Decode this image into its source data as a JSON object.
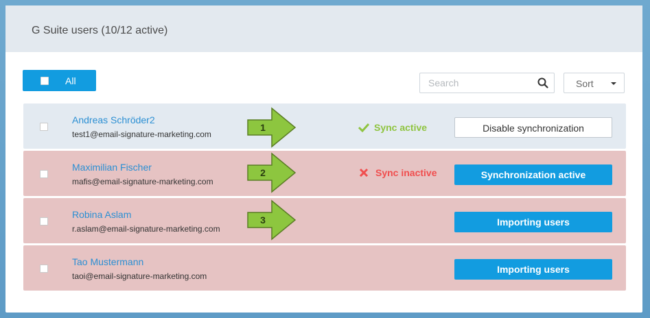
{
  "header": {
    "title": "G Suite users (10/12 active)"
  },
  "toolbar": {
    "all_label": "All",
    "search_placeholder": "Search",
    "sort_label": "Sort"
  },
  "users": [
    {
      "name": "Andreas Schröder2",
      "email": "test1@email-signature-marketing.com",
      "status": "Sync active",
      "button": "Disable synchronization",
      "callout": "1"
    },
    {
      "name": "Maximilian Fischer",
      "email": "mafis@email-signature-marketing.com",
      "status": "Sync inactive",
      "button": "Synchronization active",
      "callout": "2"
    },
    {
      "name": "Robina Aslam",
      "email": "r.aslam@email-signature-marketing.com",
      "status": "",
      "button": "Importing users",
      "callout": "3"
    },
    {
      "name": "Tao Mustermann",
      "email": "taoi@email-signature-marketing.com",
      "status": "",
      "button": "Importing users",
      "callout": ""
    }
  ],
  "colors": {
    "accent_blue": "#129ce0",
    "sync_ok_green": "#8fc440",
    "sync_bad_red": "#f04e4e",
    "callout_green": "#8dc63f"
  },
  "icons": {
    "search": "search-icon",
    "sort_caret": "chevron-down-icon",
    "sync_ok": "check-icon",
    "sync_bad": "cross-icon",
    "callout": "arrow-right-icon"
  }
}
